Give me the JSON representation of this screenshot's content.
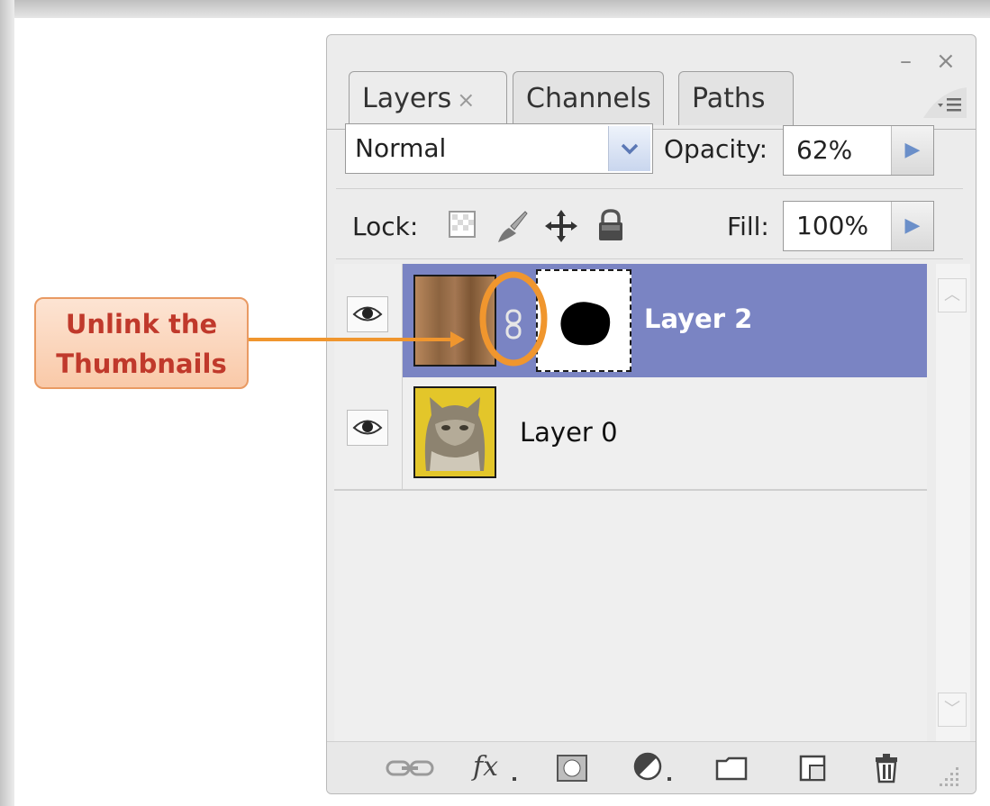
{
  "callout": {
    "line1": "Unlink the",
    "line2": "Thumbnails"
  },
  "panel": {
    "minimize_label": "–",
    "close_label": "×",
    "tabs": [
      {
        "label": "Layers",
        "active": true,
        "close": "×"
      },
      {
        "label": "Channels",
        "active": false
      },
      {
        "label": "Paths",
        "active": false
      }
    ],
    "menu_label": "▾≡",
    "blend_mode": "Normal",
    "opacity_label": "Opacity:",
    "opacity_value": "62%",
    "lock_label": "Lock:",
    "fill_label": "Fill:",
    "fill_value": "100%",
    "layers": [
      {
        "name": "Layer 2",
        "selected": true,
        "visible": true
      },
      {
        "name": "Layer 0",
        "selected": false,
        "visible": true
      }
    ]
  },
  "colors": {
    "selection": "#7a84c3",
    "accent_orange": "#f0962e",
    "callout_text": "#c0392b"
  },
  "bottom_icons": [
    "link-layers-icon",
    "fx-icon",
    "add-mask-icon",
    "adjustment-layer-icon",
    "new-group-icon",
    "new-layer-icon",
    "delete-layer-icon"
  ]
}
